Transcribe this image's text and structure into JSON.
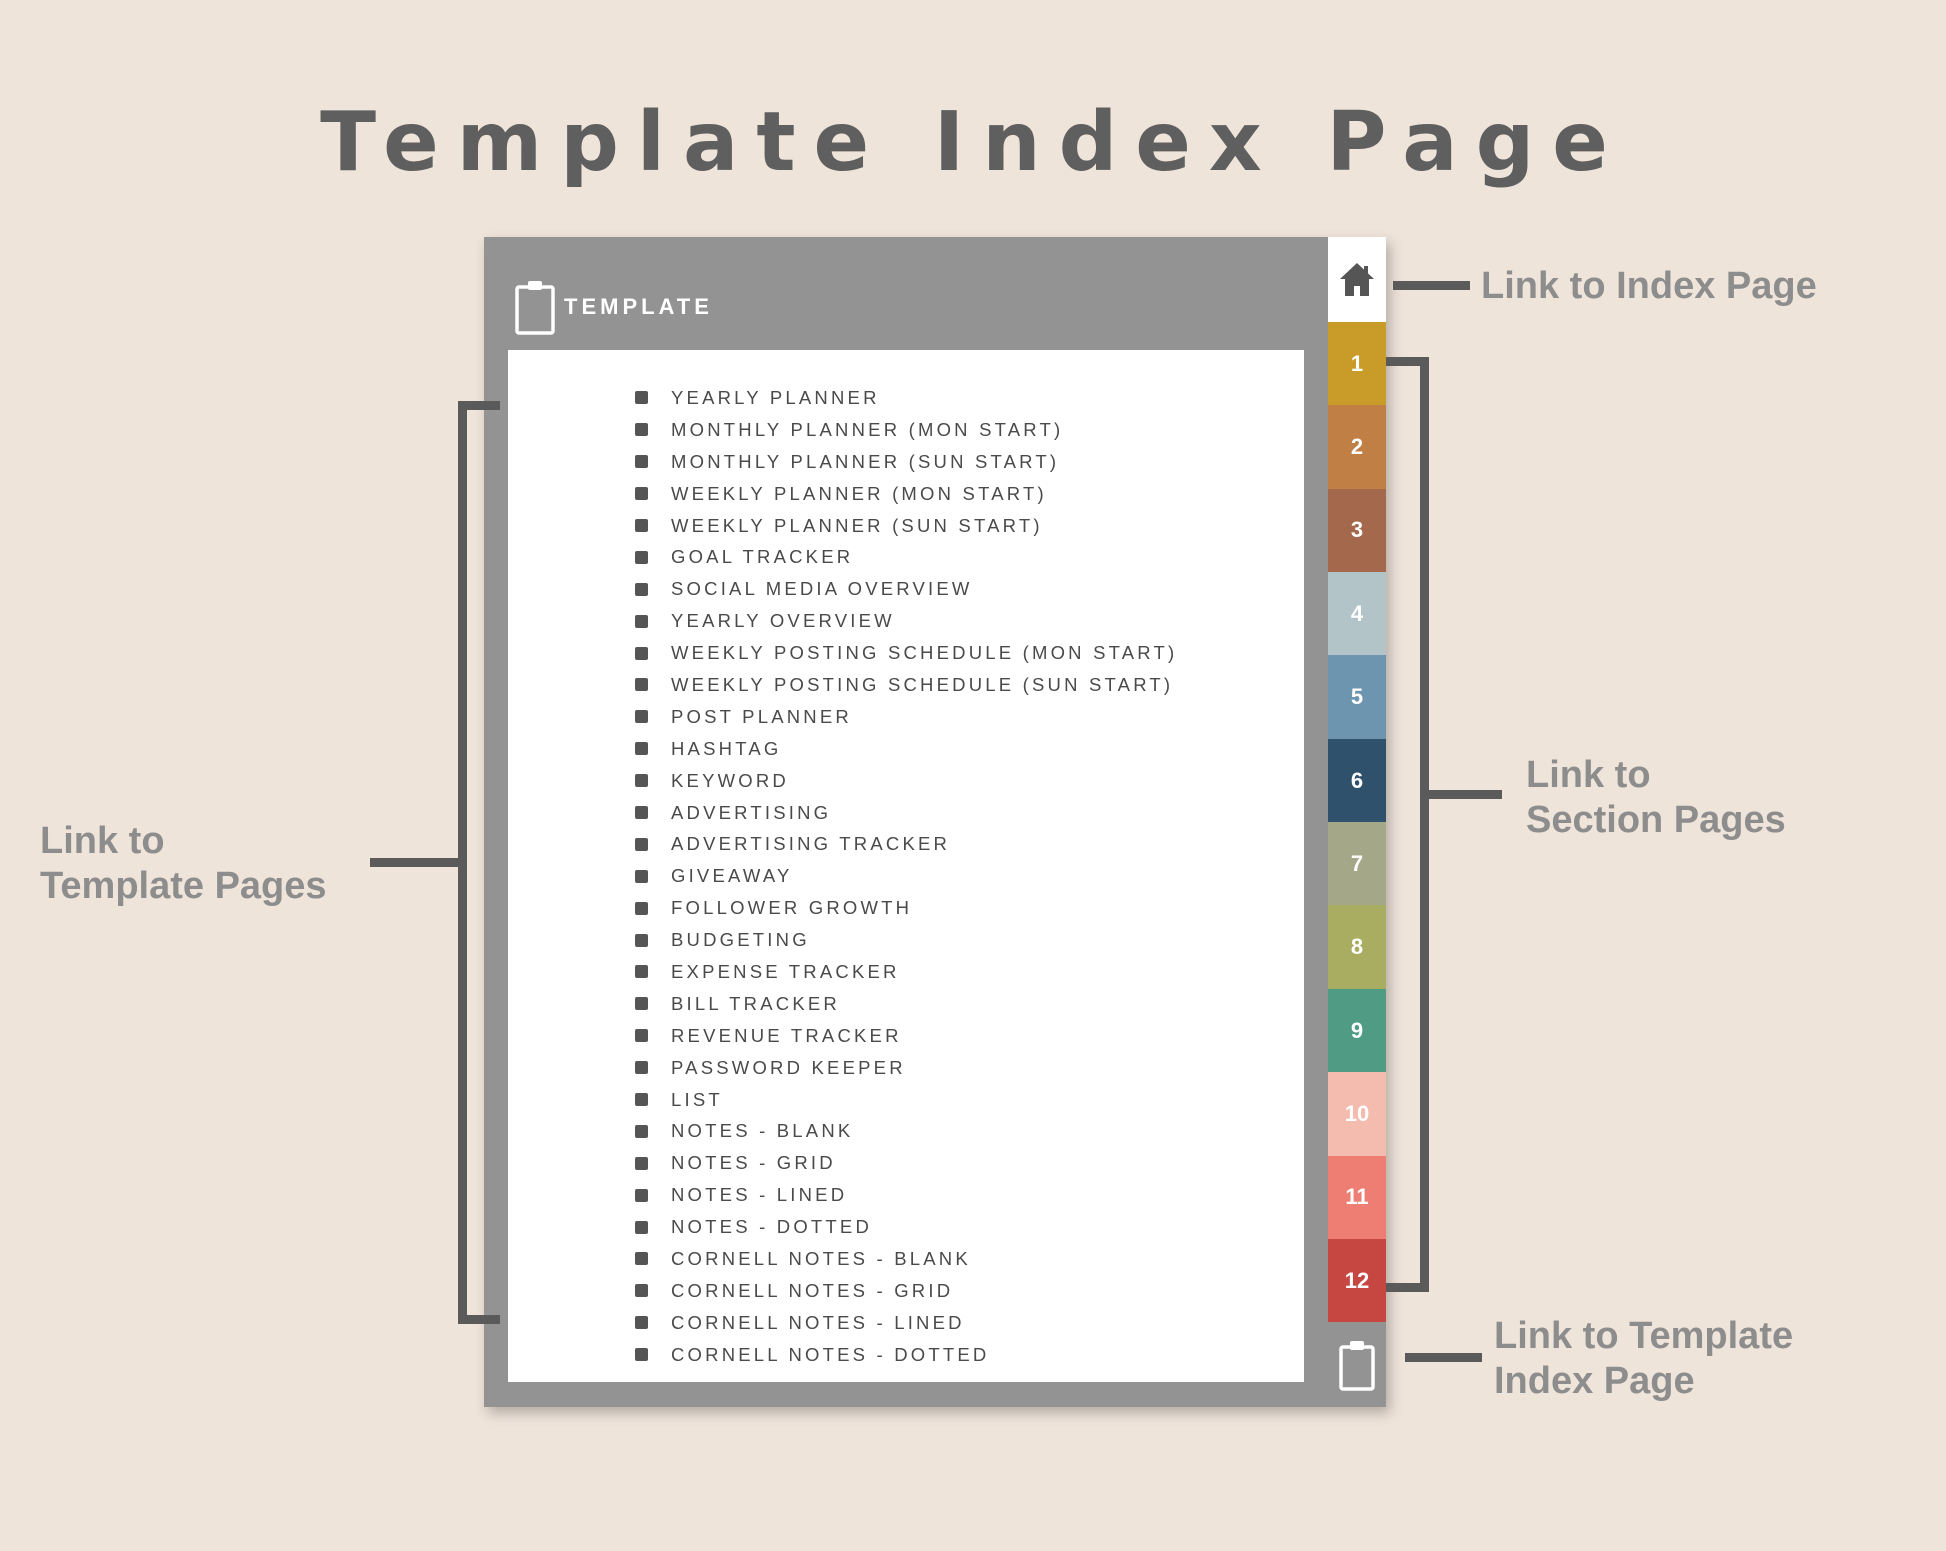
{
  "page_title": "Template Index Page",
  "planner": {
    "header_label": "TEMPLATE",
    "header_icon": "clipboard-icon",
    "template_items": [
      "YEARLY PLANNER",
      "MONTHLY PLANNER (MON START)",
      "MONTHLY PLANNER (SUN START)",
      "WEEKLY PLANNER (MON START)",
      "WEEKLY PLANNER (SUN START)",
      "GOAL TRACKER",
      "SOCIAL MEDIA OVERVIEW",
      "YEARLY OVERVIEW",
      "WEEKLY POSTING SCHEDULE (MON START)",
      "WEEKLY POSTING SCHEDULE (SUN START)",
      "POST PLANNER",
      "HASHTAG",
      "KEYWORD",
      "ADVERTISING",
      "ADVERTISING TRACKER",
      "GIVEAWAY",
      "FOLLOWER GROWTH",
      "BUDGETING",
      "EXPENSE TRACKER",
      "BILL TRACKER",
      "REVENUE TRACKER",
      "PASSWORD KEEPER",
      "LIST",
      "NOTES - BLANK",
      "NOTES - GRID",
      "NOTES - LINED",
      "NOTES - DOTTED",
      "CORNELL NOTES - BLANK",
      "CORNELL NOTES - GRID",
      "CORNELL NOTES - LINED",
      "CORNELL NOTES - DOTTED"
    ],
    "tabs": {
      "home_icon": "home-icon",
      "template_icon": "clipboard-icon",
      "sections": [
        {
          "label": "1",
          "color": "#c99b29"
        },
        {
          "label": "2",
          "color": "#c07f45"
        },
        {
          "label": "3",
          "color": "#a4684c"
        },
        {
          "label": "4",
          "color": "#b3c4c9"
        },
        {
          "label": "5",
          "color": "#6e95b0"
        },
        {
          "label": "6",
          "color": "#2f516b"
        },
        {
          "label": "7",
          "color": "#a5a789"
        },
        {
          "label": "8",
          "color": "#a9ad61"
        },
        {
          "label": "9",
          "color": "#4f9b83"
        },
        {
          "label": "10",
          "color": "#f4bcae"
        },
        {
          "label": "11",
          "color": "#ee7d73"
        },
        {
          "label": "12",
          "color": "#c64642"
        }
      ]
    }
  },
  "annotations": {
    "index_page": "Link to Index Page",
    "section_pages": {
      "line1": "Link to",
      "line2": "Section Pages"
    },
    "template_pages": {
      "line1": "Link to",
      "line2": "Template Pages"
    },
    "template_index": {
      "line1": "Link to Template",
      "line2": "Index Page"
    }
  }
}
